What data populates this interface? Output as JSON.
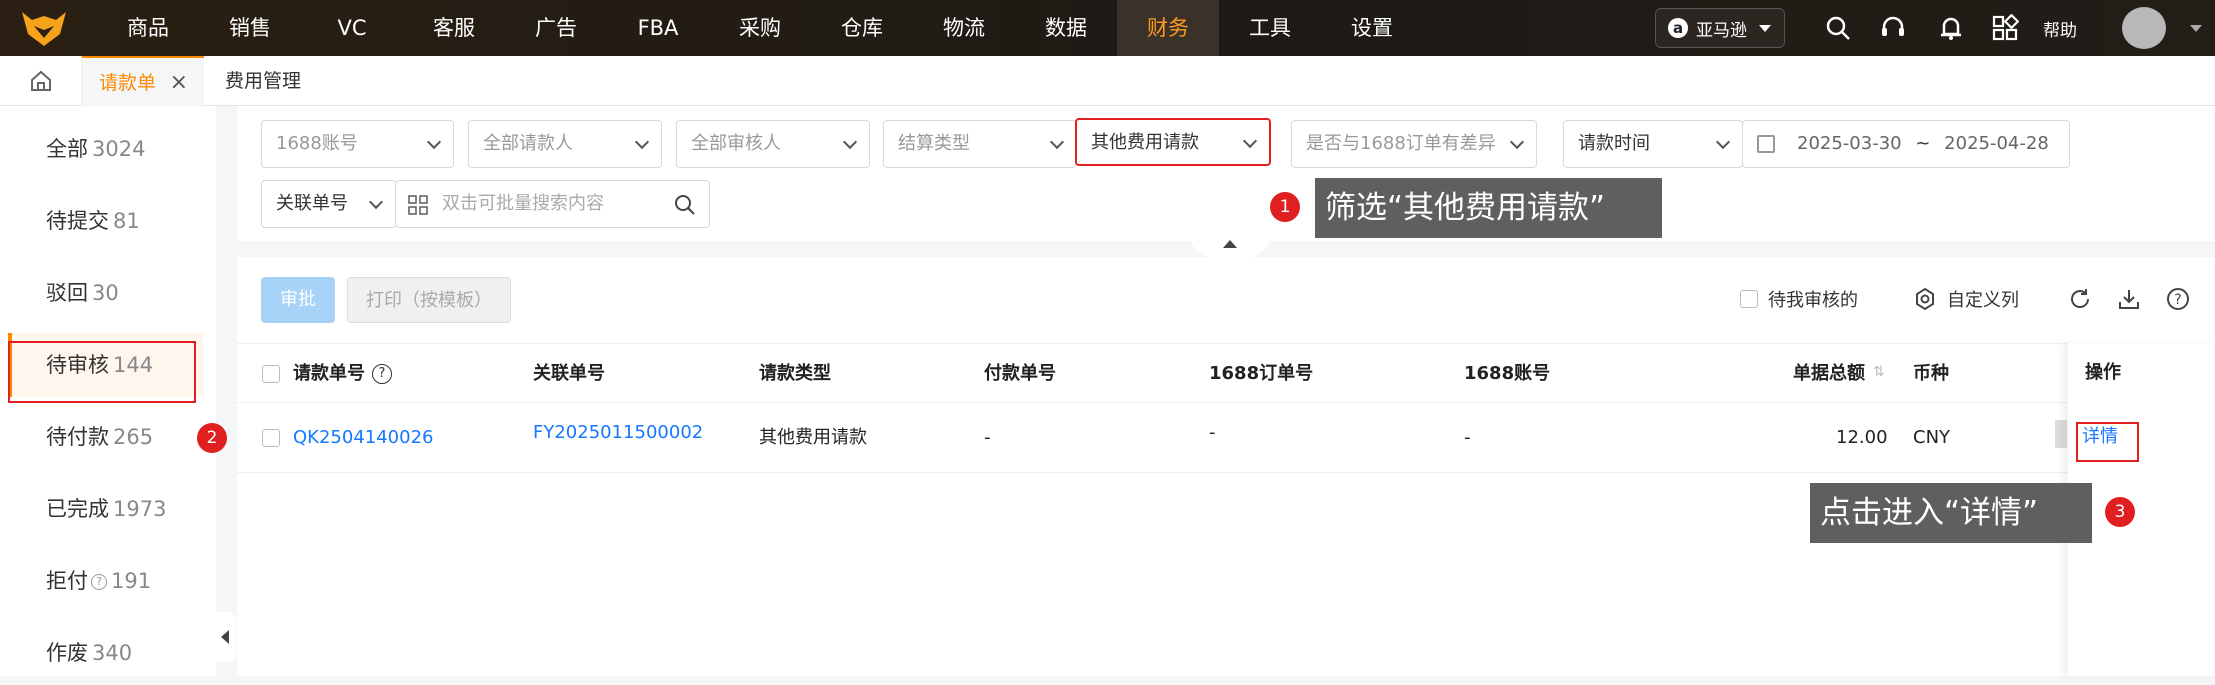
{
  "nav": {
    "items": [
      "商品",
      "销售",
      "VC",
      "客服",
      "广告",
      "FBA",
      "采购",
      "仓库",
      "物流",
      "数据",
      "财务",
      "工具",
      "设置"
    ],
    "active": "财务",
    "marketplace": "亚马逊",
    "help": "帮助"
  },
  "tabs": {
    "active": "请款单",
    "other": "费用管理"
  },
  "sidebar": {
    "items": [
      {
        "label": "全部",
        "count": "3024"
      },
      {
        "label": "待提交",
        "count": "81"
      },
      {
        "label": "驳回",
        "count": "30"
      },
      {
        "label": "待审核",
        "count": "144"
      },
      {
        "label": "待付款",
        "count": "265"
      },
      {
        "label": "已完成",
        "count": "1973"
      },
      {
        "label": "拒付",
        "count": "191"
      },
      {
        "label": "作废",
        "count": "340"
      }
    ]
  },
  "filters": {
    "account": "1688账号",
    "requester": "全部请款人",
    "reviewer": "全部审核人",
    "settle_type": "结算类型",
    "fee_type": "其他费用请款",
    "diff_1688": "是否与1688订单有差异",
    "time_type": "请款时间",
    "date_start": "2025-03-30",
    "date_sep": "~",
    "date_end": "2025-04-28",
    "link_no": "关联单号",
    "search_placeholder": "双击可批量搜索内容"
  },
  "toolbar": {
    "approve": "审批",
    "print": "打印（按模板）",
    "my_review": "待我审核的",
    "custom_cols": "自定义列"
  },
  "table": {
    "headers": [
      "请款单号",
      "关联单号",
      "请款类型",
      "付款单号",
      "1688订单号",
      "1688账号",
      "单据总额",
      "币种",
      "操作"
    ],
    "rows": [
      {
        "id": "QK2504140026",
        "link": "FY2025011500002",
        "type": "其他费用请款",
        "pay_no": "-",
        "order_1688": "-",
        "account_1688": "-",
        "total": "12.00",
        "currency": "CNY",
        "action": "详情"
      }
    ]
  },
  "annotations": {
    "tip1": "筛选“其他费用请款”",
    "tip3": "点击进入“详情”",
    "b1": "1",
    "b2": "2",
    "b3": "3"
  },
  "colors": {
    "accent": "#ff8a00",
    "link": "#1677ff",
    "annotation": "#e02020"
  }
}
